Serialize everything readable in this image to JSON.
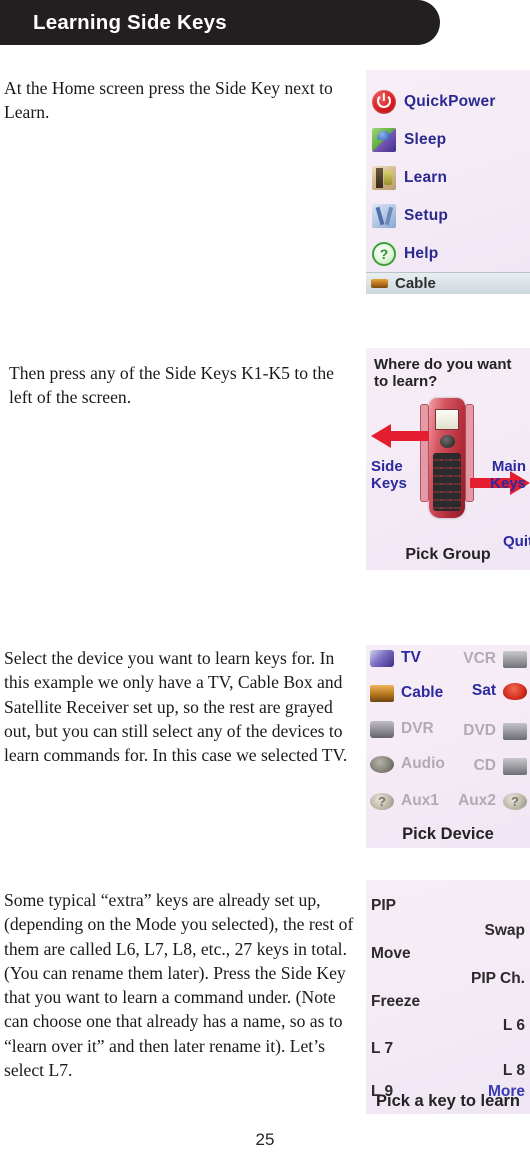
{
  "header": {
    "title": "Learning Side Keys",
    "background_color": "#231f20",
    "text_color": "#ffffff"
  },
  "steps": [
    {
      "text": "At the Home screen press the Side Key next to Learn."
    },
    {
      "text": "Then press any of the Side Keys K1-K5 to the left of the screen."
    },
    {
      "text": "Select the device you want to learn keys for. In this example we only have a TV, Cable Box and Satellite Receiver set up, so the rest are grayed out, but you can still select any of the devices to learn commands for. In this case we selected TV."
    },
    {
      "text": "Some typical “extra” keys are already set up, (depending on the Mode you selected), the rest of them are called L6, L7, L8, etc., 27 keys in total. (You can rename them later). Press the Side Key that you want to learn a command under. (Note can choose one that already has a name, so as to “learn over it” and then later rename it). Let’s select L7."
    }
  ],
  "panel_home": {
    "menu_items": [
      {
        "label": "QuickPower",
        "icon": "power-icon"
      },
      {
        "label": "Sleep",
        "icon": "sleep-icon"
      },
      {
        "label": "Learn",
        "icon": "learn-icon"
      },
      {
        "label": "Setup",
        "icon": "setup-icon"
      },
      {
        "label": "Help",
        "icon": "help-icon"
      }
    ],
    "status_bar": {
      "label": "Cable",
      "icon": "cable-box-icon"
    },
    "text_color": "#2a2a8e"
  },
  "panel_group": {
    "question_line1": "Where do you want",
    "question_line2": "to learn?",
    "side_keys_line1": "Side",
    "side_keys_line2": "Keys",
    "main_keys_line1": "Main",
    "main_keys_line2": "Keys",
    "quit_label": "Quit",
    "footer": "Pick Group",
    "arrow_color": "#e41e30",
    "label_color": "#2a2a9e"
  },
  "panel_device": {
    "rows": [
      {
        "left": {
          "label": "TV",
          "icon": "tv-icon",
          "state": "active"
        },
        "right": {
          "label": "VCR",
          "icon": "vcr-icon",
          "state": "disabled"
        }
      },
      {
        "left": {
          "label": "Cable",
          "icon": "cable-icon",
          "state": "active"
        },
        "right": {
          "label": "Sat",
          "icon": "sat-icon",
          "state": "active"
        }
      },
      {
        "left": {
          "label": "DVR",
          "icon": "dvr-icon",
          "state": "disabled"
        },
        "right": {
          "label": "DVD",
          "icon": "dvd-icon",
          "state": "disabled"
        }
      },
      {
        "left": {
          "label": "Audio",
          "icon": "audio-icon",
          "state": "disabled"
        },
        "right": {
          "label": "CD",
          "icon": "cd-icon",
          "state": "disabled"
        }
      },
      {
        "left": {
          "label": "Aux1",
          "icon": "aux-icon",
          "state": "disabled"
        },
        "right": {
          "label": "Aux2",
          "icon": "aux-icon",
          "state": "disabled"
        }
      }
    ],
    "footer": "Pick Device",
    "active_color": "#2a2a9e",
    "disabled_color": "#b0aab4"
  },
  "panel_keys": {
    "left_keys": [
      "PIP",
      "Move",
      "Freeze",
      "L 7",
      "L 9"
    ],
    "right_keys": [
      "Swap",
      "PIP Ch.",
      "L 6",
      "L 8",
      "More"
    ],
    "more_label": "More",
    "more_color": "#3a3ab4",
    "footer": "Pick a key to learn"
  },
  "page_number": "25"
}
